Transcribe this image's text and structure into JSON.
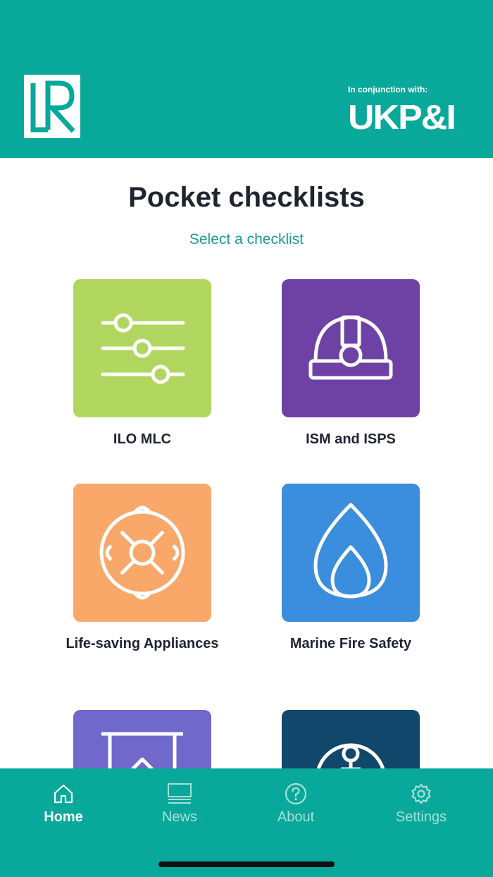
{
  "header": {
    "partner_label": "In conjunction with:",
    "partner_logo_text": "UKP&I",
    "left_logo_text": "LR",
    "background_color": "#08a89a"
  },
  "main": {
    "title": "Pocket checklists",
    "subtitle": "Select a checklist",
    "tiles": [
      {
        "label": "ILO MLC",
        "icon": "sliders-icon",
        "color": "#b1d660"
      },
      {
        "label": "ISM and ISPS",
        "icon": "hard-hat-icon",
        "color": "#6e42a4"
      },
      {
        "label": "Life-saving Appliances",
        "icon": "lifebuoy-icon",
        "color": "#f9a86a"
      },
      {
        "label": "Marine Fire Safety",
        "icon": "flame-icon",
        "color": "#3b8ddd"
      },
      {
        "label": "",
        "icon": "banner-icon",
        "color": "#7168cc"
      },
      {
        "label": "",
        "icon": "anchor-icon",
        "color": "#10476a"
      }
    ]
  },
  "tabbar": {
    "items": [
      {
        "label": "Home",
        "icon": "home-icon",
        "active": true
      },
      {
        "label": "News",
        "icon": "news-icon",
        "active": false
      },
      {
        "label": "About",
        "icon": "question-icon",
        "active": false
      },
      {
        "label": "Settings",
        "icon": "gear-icon",
        "active": false
      }
    ]
  }
}
